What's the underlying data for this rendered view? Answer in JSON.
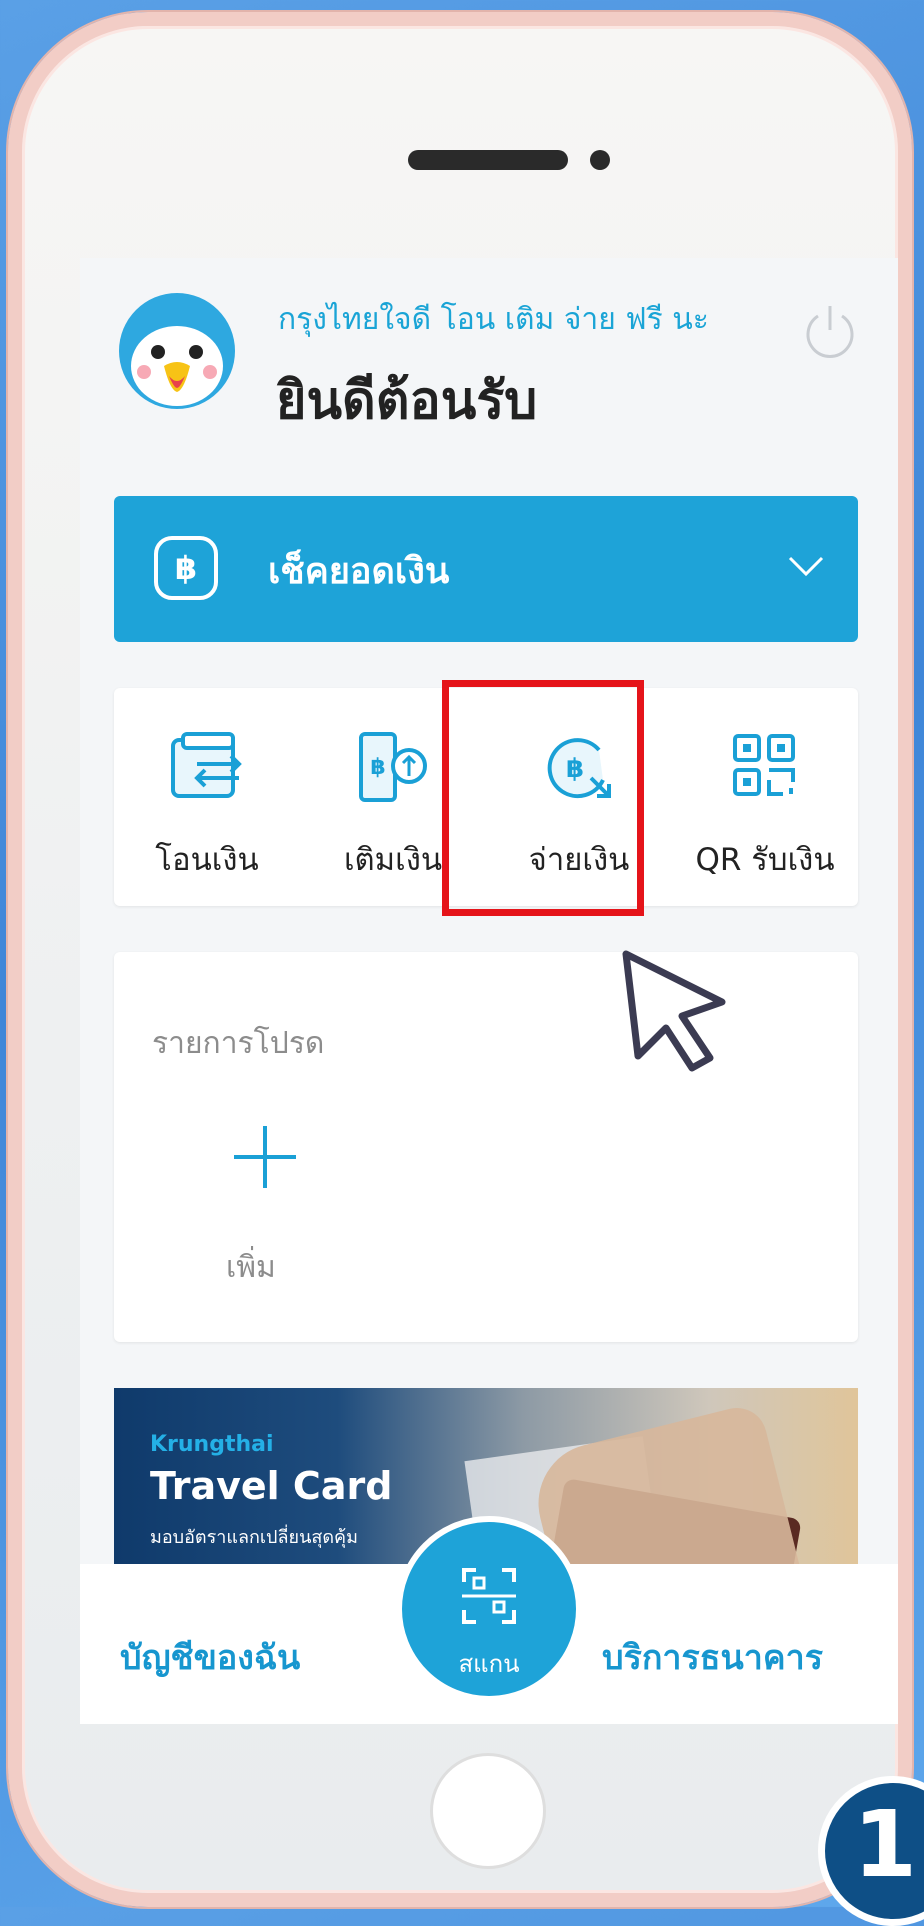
{
  "header": {
    "greeting": "กรุงไทยใจดี โอน เติม จ่าย ฟรี นะ",
    "welcome": "ยินดีต้อนรับ"
  },
  "balance": {
    "label": "เช็คยอดเงิน",
    "currency_symbol": "฿"
  },
  "actions": [
    {
      "label": "โอนเงิน",
      "icon": "wallet-transfer-icon"
    },
    {
      "label": "เติมเงิน",
      "icon": "phone-topup-icon"
    },
    {
      "label": "จ่ายเงิน",
      "icon": "baht-pay-icon",
      "highlighted": true
    },
    {
      "label": "QR รับเงิน",
      "icon": "qr-code-icon"
    }
  ],
  "favorites": {
    "title": "รายการโปรด",
    "add_label": "เพิ่ม"
  },
  "banner": {
    "brand": "Krungthai",
    "title": "Travel Card",
    "subtitle": "มอบอัตราแลกเปลี่ยนสุดคุ้ม"
  },
  "tabbar": {
    "left": "บัญชีของฉัน",
    "scan": "สแกน",
    "right": "บริการธนาคาร"
  },
  "step_badge": "1",
  "colors": {
    "accent": "#1ea3d8",
    "highlight": "#e5141a",
    "badge": "#0e4f86"
  }
}
